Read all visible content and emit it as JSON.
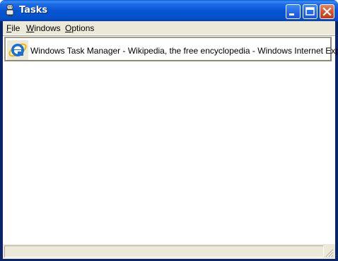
{
  "window": {
    "title": "Tasks",
    "app_icon": "tasks-app-icon",
    "controls": {
      "minimize": "minimize-icon",
      "maximize": "maximize-icon",
      "close": "close-icon"
    }
  },
  "menu": {
    "items": [
      {
        "mnemonic": "F",
        "rest": "ile"
      },
      {
        "mnemonic": "W",
        "rest": "indows"
      },
      {
        "mnemonic": "O",
        "rest": "ptions"
      }
    ]
  },
  "tasks": [
    {
      "label": "Windows Task Manager - Wikipedia, the free encyclopedia - Windows Internet Explorer",
      "icon": "internet-explorer-icon"
    }
  ],
  "colors": {
    "titlebar": "#0654d4",
    "close_button": "#d4512c",
    "frame": "#ece9d8",
    "ie_blue": "#1a6fd6",
    "ie_ring": "#f2b600"
  }
}
